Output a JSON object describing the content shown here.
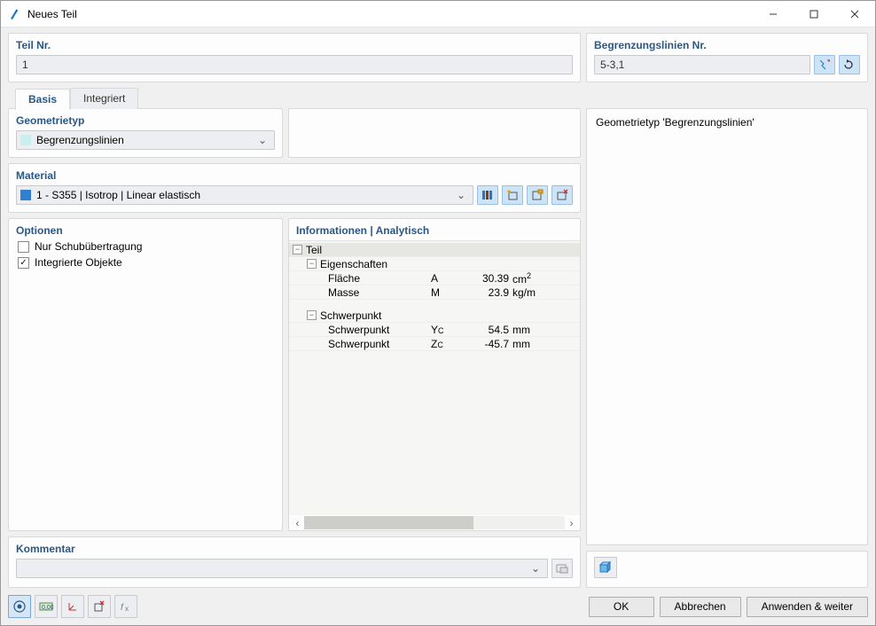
{
  "window": {
    "title": "Neues Teil"
  },
  "top": {
    "teil_nr_label": "Teil Nr.",
    "teil_nr_value": "1",
    "begr_label": "Begrenzungslinien Nr.",
    "begr_value": "5-3,1"
  },
  "tabs": {
    "basis": "Basis",
    "integriert": "Integriert"
  },
  "geom": {
    "title": "Geometrietyp",
    "value": "Begrenzungslinien"
  },
  "material": {
    "title": "Material",
    "value": "1 - S355 | Isotrop | Linear elastisch"
  },
  "options": {
    "title": "Optionen",
    "schub": "Nur Schubübertragung",
    "integ": "Integrierte Objekte"
  },
  "info": {
    "title": "Informationen | Analytisch",
    "teil": "Teil",
    "eig": "Eigenschaften",
    "flaeche": "Fläche",
    "flaeche_sym": "A",
    "flaeche_val": "30.39",
    "flaeche_unit": "cm",
    "masse": "Masse",
    "masse_sym": "M",
    "masse_val": "23.9",
    "masse_unit": "kg/m",
    "schwer": "Schwerpunkt",
    "schwer1": "Schwerpunkt",
    "schwer1_sym": "Y",
    "schwer1_val": "54.5",
    "schwer1_unit": "mm",
    "schwer2": "Schwerpunkt",
    "schwer2_sym": "Z",
    "schwer2_val": "-45.7",
    "schwer2_unit": "mm"
  },
  "right": {
    "geom_info": "Geometrietyp 'Begrenzungslinien'"
  },
  "comment": {
    "title": "Kommentar",
    "value": ""
  },
  "footer": {
    "ok": "OK",
    "cancel": "Abbrechen",
    "apply": "Anwenden & weiter"
  }
}
